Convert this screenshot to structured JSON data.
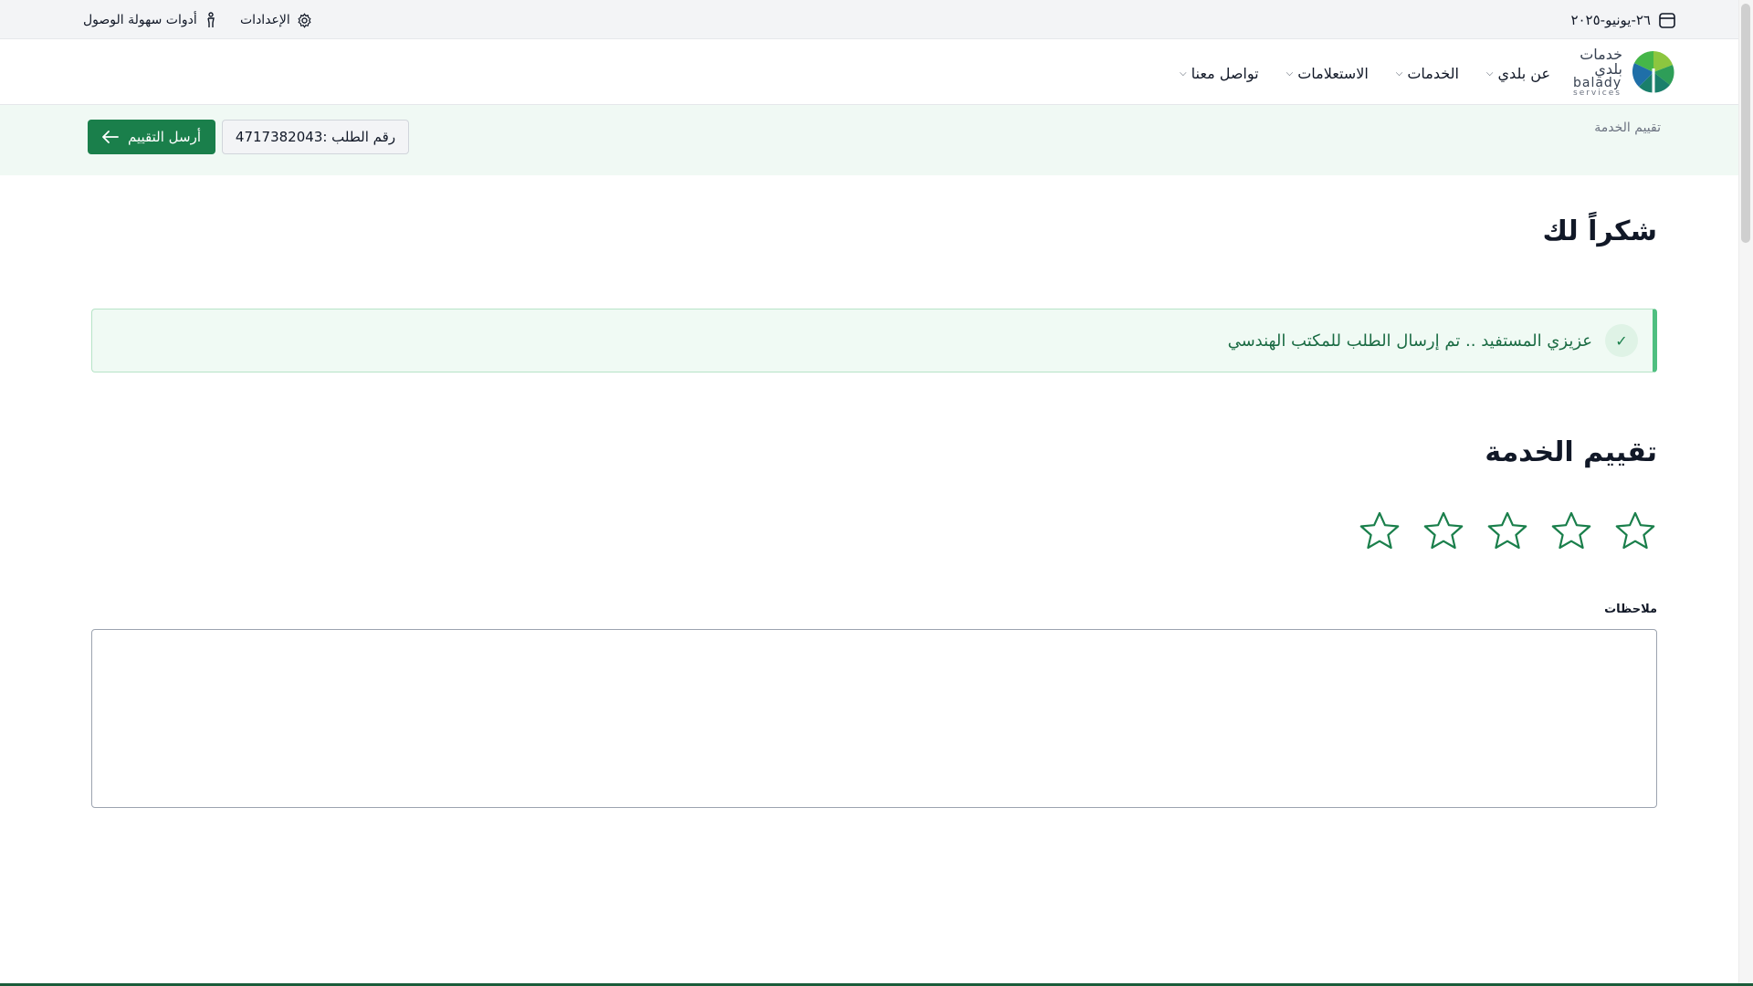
{
  "topbar": {
    "date": "٢٦-يونيو-٢٠٢٥",
    "date_icon": "calendar-icon",
    "settings_label": "الإعدادات",
    "settings_icon": "gear-icon",
    "accessibility_label": "أدوات سهولة الوصول",
    "accessibility_icon": "accessibility-icon"
  },
  "logo": {
    "arabic": "خدمات بلدي",
    "english": "balady",
    "sub": "services"
  },
  "nav": {
    "items": [
      {
        "label": "عن بلدي",
        "has_dropdown": true
      },
      {
        "label": "الخدمات",
        "has_dropdown": true
      },
      {
        "label": "الاستعلامات",
        "has_dropdown": true
      },
      {
        "label": "تواصل معنا",
        "has_dropdown": true
      }
    ]
  },
  "band": {
    "breadcrumb": "تقييم الخدمة",
    "order_number": "رقم الطلب :4717382043",
    "send_label": "أرسل التقييم"
  },
  "content": {
    "thanks_title": "شكراً لك",
    "alert_text": "عزيزي المستفيد .. تم إرسال الطلب للمكتب الهندسي",
    "rating_title": "تقييم الخدمة",
    "rating": {
      "value": 0,
      "max": 5
    },
    "notes_label": "ملاحظات",
    "notes_value": ""
  },
  "colors": {
    "accent": "#1a7f4b",
    "band_bg": "#f0f9f4",
    "alert_border": "#4fbf80"
  }
}
